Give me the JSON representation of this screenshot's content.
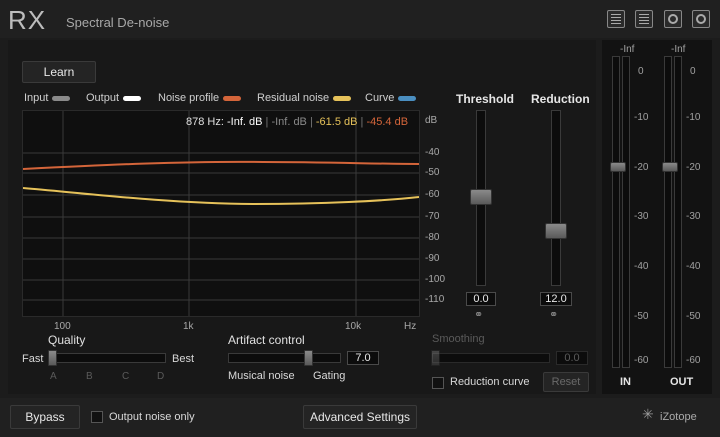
{
  "app": {
    "logo": "RX",
    "title": "Spectral De-noise"
  },
  "header_icons": [
    "list-icon",
    "document-icon",
    "record-icon",
    "help-icon"
  ],
  "learn_button": "Learn",
  "legend": [
    {
      "label": "Input",
      "color": "#8a8a8a"
    },
    {
      "label": "Output",
      "color": "#ffffff"
    },
    {
      "label": "Noise profile",
      "color": "#d4653a"
    },
    {
      "label": "Residual noise",
      "color": "#e6c25a"
    },
    {
      "label": "Curve",
      "color": "#4a8ec0"
    }
  ],
  "readout": {
    "freq": "878 Hz:",
    "input": "-Inf. dB",
    "sep1": "|",
    "output": "-Inf. dB",
    "sep2": "|",
    "residual": "-61.5 dB",
    "sep3": "|",
    "noise": "-45.4 dB"
  },
  "db_axis": {
    "unit": "dB",
    "labels": [
      "-40",
      "-50",
      "-60",
      "-70",
      "-80",
      "-90",
      "-100",
      "-110"
    ]
  },
  "freq_axis": [
    "100",
    "1k",
    "10k",
    "Hz"
  ],
  "threshold": {
    "label": "Threshold",
    "value": "0.0",
    "level": 0.45
  },
  "reduction": {
    "label": "Reduction",
    "value": "12.0",
    "level": 0.62
  },
  "quality": {
    "label": "Quality",
    "left": "Fast",
    "right": "Best",
    "ticks": [
      "A",
      "B",
      "C",
      "D"
    ]
  },
  "artifact": {
    "label": "Artifact control",
    "value": "7.0",
    "left": "Musical noise",
    "right": "Gating",
    "level": 0.7
  },
  "smoothing": {
    "label": "Smoothing",
    "value": "0.0"
  },
  "reduction_curve": "Reduction curve",
  "reset": "Reset",
  "meters": {
    "in_label": "IN",
    "out_label": "OUT",
    "top": "-Inf",
    "scale": [
      "0",
      "-10",
      "-20",
      "-30",
      "-40",
      "-50",
      "-60"
    ]
  },
  "footer": {
    "bypass": "Bypass",
    "output_noise_only": "Output noise only",
    "advanced": "Advanced Settings",
    "brand": "iZotope"
  }
}
